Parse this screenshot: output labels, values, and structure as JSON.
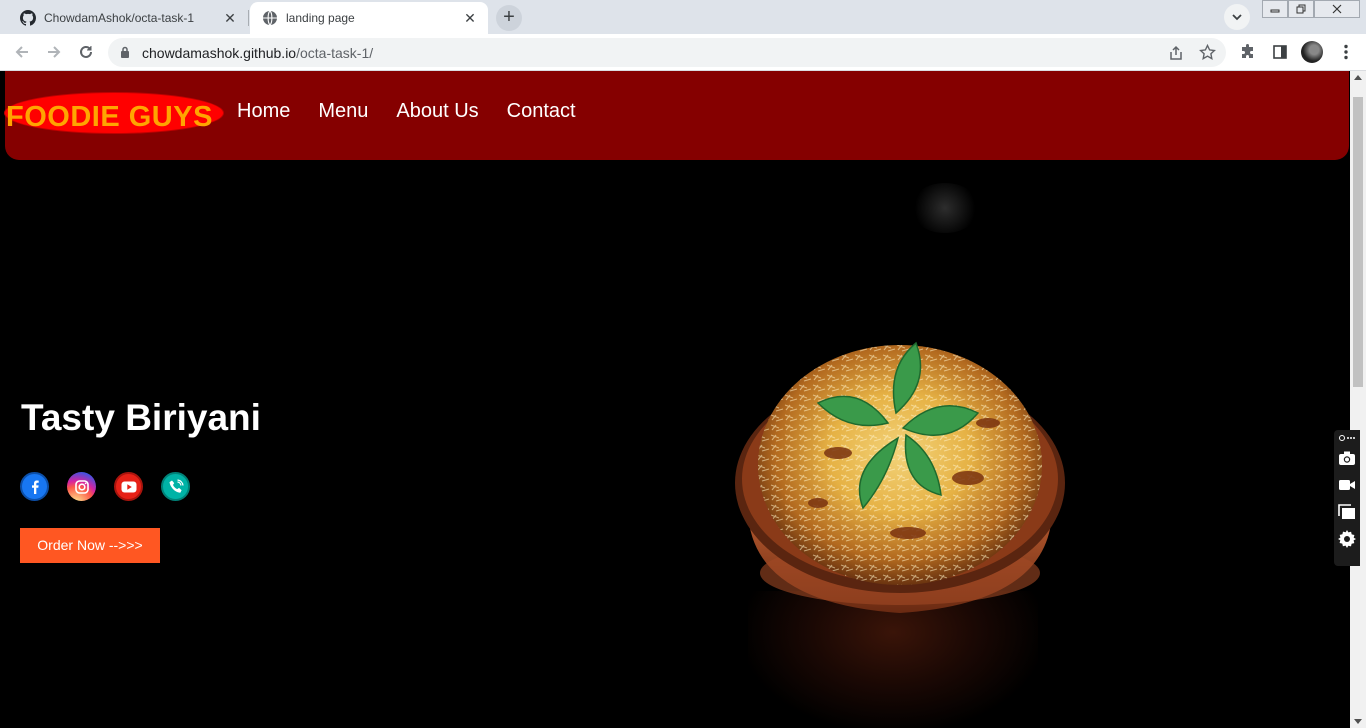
{
  "browser": {
    "tabs": [
      {
        "title": "ChowdamAshok/octa-task-1",
        "icon": "github-icon",
        "active": false
      },
      {
        "title": "landing page",
        "icon": "globe-icon",
        "active": true
      }
    ],
    "close_glyph": "✕",
    "new_tab_glyph": "+",
    "url_host": "chowdamashok.github.io",
    "url_path": "/octa-task-1/"
  },
  "site": {
    "logo": "FOODIE GUYS",
    "nav": [
      "Home",
      "Menu",
      "About Us",
      "Contact"
    ],
    "hero": {
      "title": "Tasty Biriyani",
      "order_button": "Order Now -->>>"
    },
    "socials": [
      {
        "name": "facebook-icon",
        "color": "#1877f2"
      },
      {
        "name": "instagram-icon",
        "color": "#d62976"
      },
      {
        "name": "youtube-icon",
        "color": "#e62117"
      },
      {
        "name": "phone-icon",
        "color": "#00b3a6"
      }
    ],
    "colors": {
      "navbar": "#850000",
      "logo_bg": "#ff0000",
      "logo_text": "#ffa500",
      "button": "#ff5722"
    }
  }
}
